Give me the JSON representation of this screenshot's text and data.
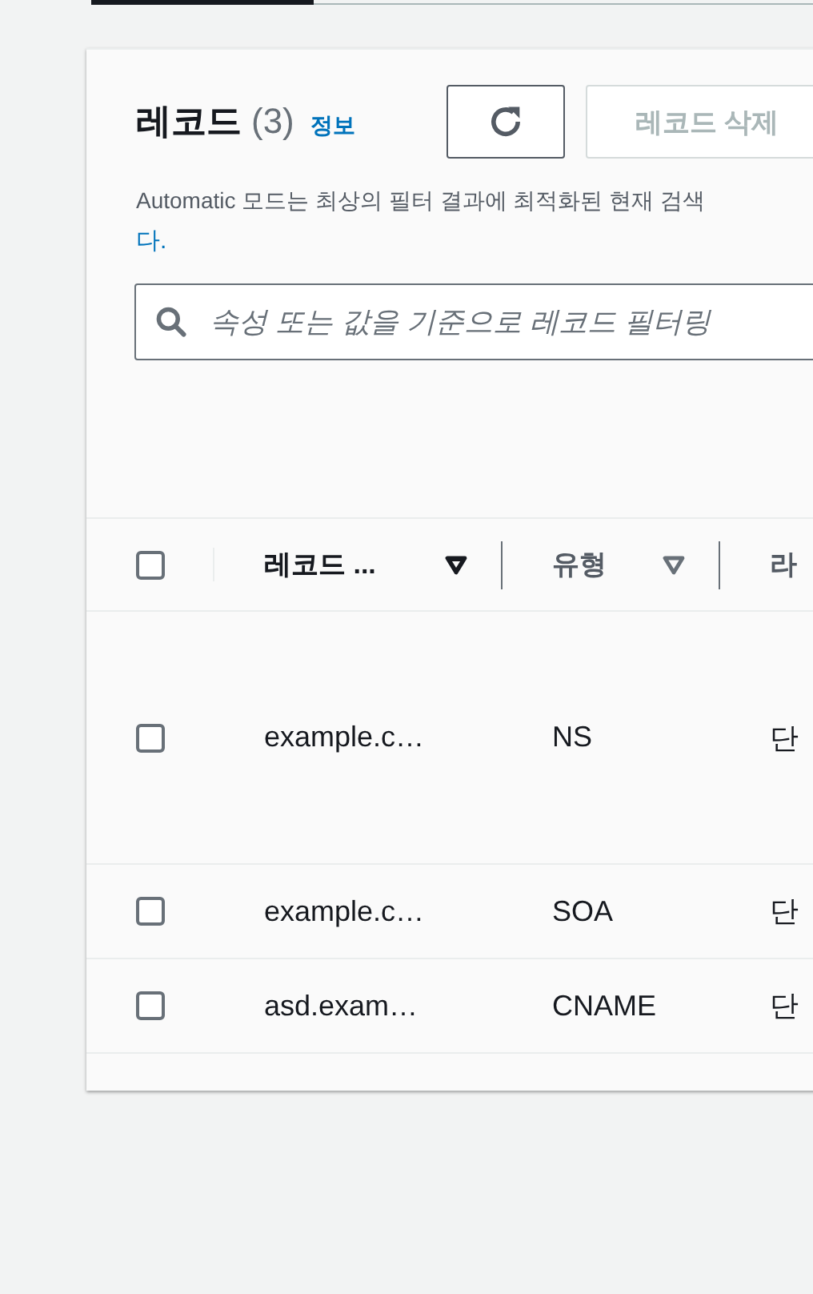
{
  "panel": {
    "title": "레코드",
    "count": "(3)",
    "info_link": "정보",
    "delete_button": {
      "label": "레코드 삭제",
      "disabled": true
    },
    "description": "Automatic 모드는 최상의 필터 결과에 최적화된 현재 검색",
    "description_link": "다.",
    "search": {
      "placeholder": "속성 또는 값을 기준으로 레코드 필터링"
    }
  },
  "table": {
    "select_all": {
      "checked": false
    },
    "columns": [
      {
        "label": "레코드 ...",
        "sorted": true
      },
      {
        "label": "유형",
        "sorted": false
      },
      {
        "label": "라"
      }
    ],
    "rows": [
      {
        "checked": false,
        "name": "example.c…",
        "type": "NS",
        "column_3": "단",
        "tall": true
      },
      {
        "checked": false,
        "name": "example.c…",
        "type": "SOA",
        "column_3": "단",
        "tall": false
      },
      {
        "checked": false,
        "name": "asd.exam…",
        "type": "CNAME",
        "column_3": "단",
        "tall": false
      }
    ]
  }
}
